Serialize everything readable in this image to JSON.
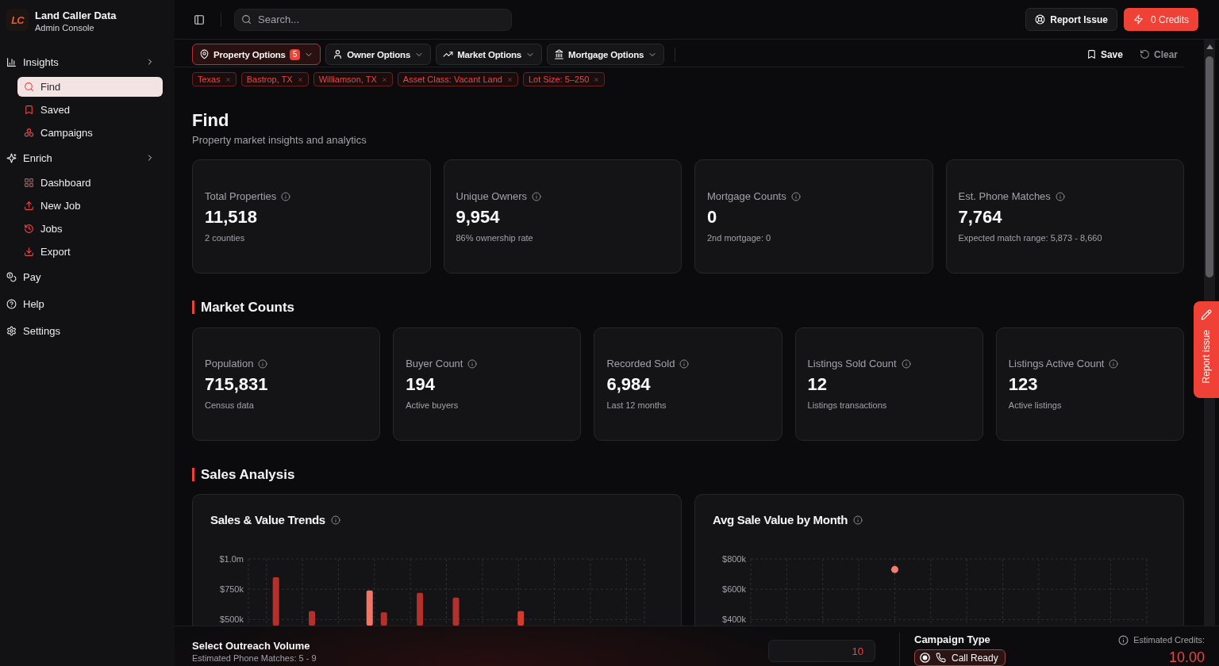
{
  "sidebar": {
    "logo": "LC",
    "app_name": "Land Caller Data",
    "app_subtitle": "Admin Console",
    "nav": [
      {
        "label": "Insights",
        "selected": false,
        "children": [
          {
            "label": "Find",
            "selected": true
          },
          {
            "label": "Saved",
            "selected": false
          },
          {
            "label": "Campaigns",
            "selected": false
          }
        ]
      },
      {
        "label": "Enrich",
        "selected": false,
        "children": [
          {
            "label": "Dashboard",
            "selected": false
          },
          {
            "label": "New Job",
            "selected": false
          },
          {
            "label": "Jobs",
            "selected": false
          },
          {
            "label": "Export",
            "selected": false
          }
        ]
      },
      {
        "label": "Pay",
        "selected": false
      },
      {
        "label": "Help",
        "selected": false
      },
      {
        "label": "Settings",
        "selected": false
      }
    ]
  },
  "header": {
    "search": {
      "placeholder": "Search..."
    },
    "report_button": "Report Issue",
    "credits_button": "0 Credits"
  },
  "filters": {
    "options": [
      {
        "label": "Property Options",
        "active": true,
        "badge": "5"
      },
      {
        "label": "Owner Options",
        "active": false
      },
      {
        "label": "Market Options",
        "active": false
      },
      {
        "label": "Mortgage Options",
        "active": false
      }
    ],
    "actions": [
      {
        "label": "Save",
        "kind": "save"
      },
      {
        "label": "Clear",
        "kind": "clear"
      }
    ],
    "chips": [
      "Texas",
      "Bastrop, TX",
      "Williamson, TX",
      "Asset Class: Vacant Land",
      "Lot Size: 5–250"
    ]
  },
  "page": {
    "title": "Find",
    "subtitle": "Property market insights and analytics"
  },
  "summary_cards": [
    {
      "label": "Total Properties",
      "value": "11,518",
      "note": "2 counties"
    },
    {
      "label": "Unique Owners",
      "value": "9,954",
      "note": "86% ownership rate"
    },
    {
      "label": "Mortgage Counts",
      "value": "0",
      "note": "2nd mortgage: 0"
    },
    {
      "label": "Est. Phone Matches",
      "value": "7,764",
      "note": "Expected match range: 5,873 - 8,660"
    }
  ],
  "market_counts": {
    "title": "Market Counts",
    "cards": [
      {
        "label": "Population",
        "value": "715,831",
        "note": "Census data"
      },
      {
        "label": "Buyer Count",
        "value": "194",
        "note": "Active buyers"
      },
      {
        "label": "Recorded Sold",
        "value": "6,984",
        "note": "Last 12 months"
      },
      {
        "label": "Listings Sold Count",
        "value": "12",
        "note": "Listings transactions"
      },
      {
        "label": "Listings Active Count",
        "value": "123",
        "note": "Active listings"
      }
    ]
  },
  "sales_analysis": {
    "title": "Sales Analysis",
    "charts": [
      {
        "chart_data": {
          "type": "bar",
          "title": "Sales & Value Trends",
          "ylim": [
            450000,
            1000000
          ],
          "yticks": [
            {
              "value": 500000,
              "label": "$500k"
            },
            {
              "value": 750000,
              "label": "$750k"
            },
            {
              "value": 1000000,
              "label": "$1.0m"
            }
          ],
          "grid": true,
          "stacked": false,
          "series": [
            {
              "color": "#f0766a",
              "values": [
                null,
                null,
                null,
                740000,
                null,
                null,
                null,
                null,
                null,
                null,
                null
              ]
            },
            {
              "color": "#d9382c",
              "values": [
                null,
                null,
                null,
                null,
                null,
                null,
                null,
                570000,
                null,
                null,
                null
              ]
            },
            {
              "color": "#b3312a",
              "values": [
                850000,
                570000,
                null,
                560000,
                720000,
                680000,
                null,
                null,
                null,
                null,
                null
              ]
            }
          ]
        }
      },
      {
        "chart_data": {
          "type": "scatter",
          "title": "Avg Sale Value by Month",
          "ylim": [
            360000,
            800000
          ],
          "yticks": [
            {
              "value": 400000,
              "label": "$400k"
            },
            {
              "value": 600000,
              "label": "$600k"
            },
            {
              "value": 800000,
              "label": "$800k"
            }
          ],
          "grid": true,
          "series": [
            {
              "color": "#f47c70",
              "values": [
                null,
                null,
                null,
                null,
                730000,
                null,
                null,
                null,
                null,
                null,
                null,
                null
              ]
            }
          ]
        }
      }
    ]
  },
  "bottom_bar": {
    "outreach": {
      "title": "Select Outreach Volume",
      "subtitle": "Estimated Phone Matches: 5 - 9",
      "value": "10"
    },
    "campaign_type": {
      "label": "Campaign Type",
      "options": [
        {
          "label": "Call Ready",
          "selected": true
        }
      ]
    },
    "credits": {
      "label": "Estimated Credits:",
      "value": "10.00"
    }
  },
  "report_tab": "Report issue"
}
